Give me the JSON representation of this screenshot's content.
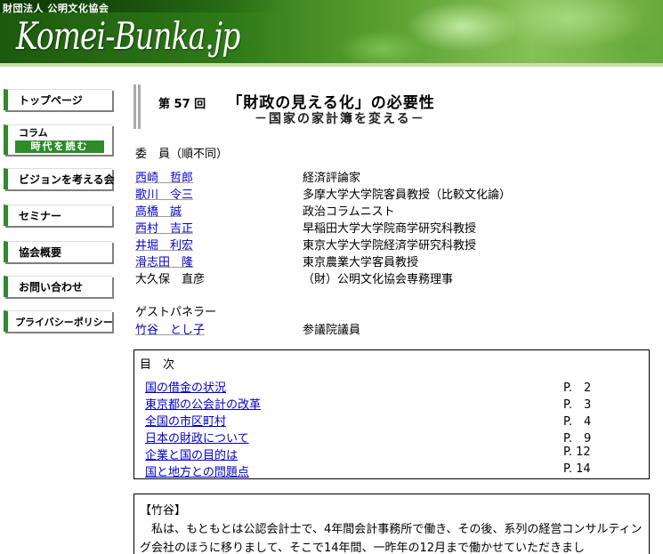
{
  "header": {
    "org_name": "財団法人 公明文化協会",
    "logo": "Komei-Bunka.jp"
  },
  "sidebar": {
    "items": [
      {
        "label": "トップページ"
      },
      {
        "label_top": "コラム",
        "label_bottom": "時代を読む"
      },
      {
        "label": "ビジョンを考える会"
      },
      {
        "label": "セミナー"
      },
      {
        "label": "協会概要"
      },
      {
        "label": "お問い合わせ"
      },
      {
        "label": "プライバシーポリシー"
      }
    ]
  },
  "article": {
    "issue": "第 57 回",
    "title": "「財政の見える化」の必要性",
    "subtitle": "－国家の家計簿を変える－"
  },
  "committee": {
    "heading": "委　員（順不同）",
    "members": [
      {
        "name": "西崎　哲郎",
        "title": "経済評論家",
        "link": true
      },
      {
        "name": "歌川　令三",
        "title": "多摩大学大学院客員教授（比較文化論）",
        "link": true
      },
      {
        "name": "高橋　誠",
        "title": "政治コラムニスト",
        "link": true
      },
      {
        "name": "西村　吉正",
        "title": "早稲田大学大学院商学研究科教授",
        "link": true
      },
      {
        "name": "井堀　利宏",
        "title": "東京大学大学院経済学研究科教授",
        "link": true
      },
      {
        "name": "滑志田　隆",
        "title": "東京農業大学客員教授",
        "link": true
      },
      {
        "name": "大久保　直彦",
        "title": "（財）公明文化協会専務理事",
        "link": false
      }
    ]
  },
  "guest": {
    "heading": "ゲストパネラー",
    "members": [
      {
        "name": "竹谷　とし子",
        "title": "参議院議員"
      }
    ]
  },
  "toc": {
    "heading": "目　次",
    "items": [
      {
        "label": "国の借金の状況",
        "page": "P.　2"
      },
      {
        "label": "東京都の公会計の改革",
        "page": "P.　3"
      },
      {
        "label": "全国の市区町村",
        "page": "P.　4"
      },
      {
        "label": "日本の財政について",
        "page": "P.　9"
      },
      {
        "label": "企業と国の目的は",
        "page": "P. 12"
      },
      {
        "label": "国と地方との問題点",
        "page": "P. 14"
      }
    ]
  },
  "body": {
    "speaker": "【竹谷】",
    "text": "私は、もともとは公認会計士で、4年間会計事務所で働き、その後、系列の経営コンサルティング会社のほうに移りまして、そこで14年間、一昨年の12月まで働かせていただきまし"
  }
}
